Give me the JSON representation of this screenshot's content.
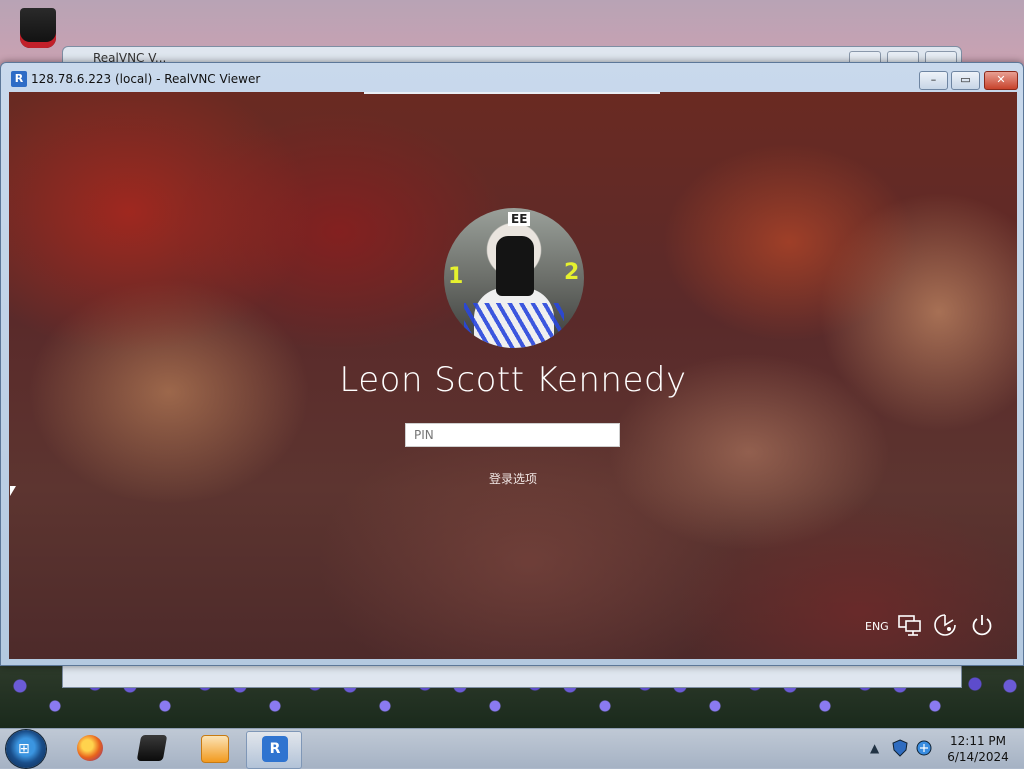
{
  "desktop": {
    "recycle_bin": "recycle-bin-icon"
  },
  "background_window": {
    "title": "RealVNC V..."
  },
  "window": {
    "title": "128.78.6.223 (local) - RealVNC Viewer",
    "controls": {
      "minimize": "–",
      "maximize": "▭",
      "close": "✕"
    }
  },
  "lockscreen": {
    "username": "Leon Scott Kennedy",
    "pin_placeholder": "PIN",
    "pin_value": "",
    "signin_options": "登录选项",
    "language": "ENG",
    "icons": {
      "network": "network-icon",
      "accessibility": "ease-of-access-icon",
      "power": "power-icon"
    },
    "avatar_badge": "EE",
    "avatar_numbers": [
      "1",
      "2"
    ]
  },
  "taskbar": {
    "start_label": "start-button",
    "pinned": [
      {
        "name": "firefox",
        "color": "#e8631c"
      },
      {
        "name": "terminal",
        "color": "#111111"
      },
      {
        "name": "media-player",
        "color": "#f29a1f"
      },
      {
        "name": "realvnc",
        "color": "#2f74d0"
      }
    ],
    "tray": {
      "show_hidden": "▲",
      "time": "12:11 PM",
      "date": "6/14/2024"
    }
  },
  "colors": {
    "accent": "#2f74d0",
    "close": "#c7432c"
  }
}
